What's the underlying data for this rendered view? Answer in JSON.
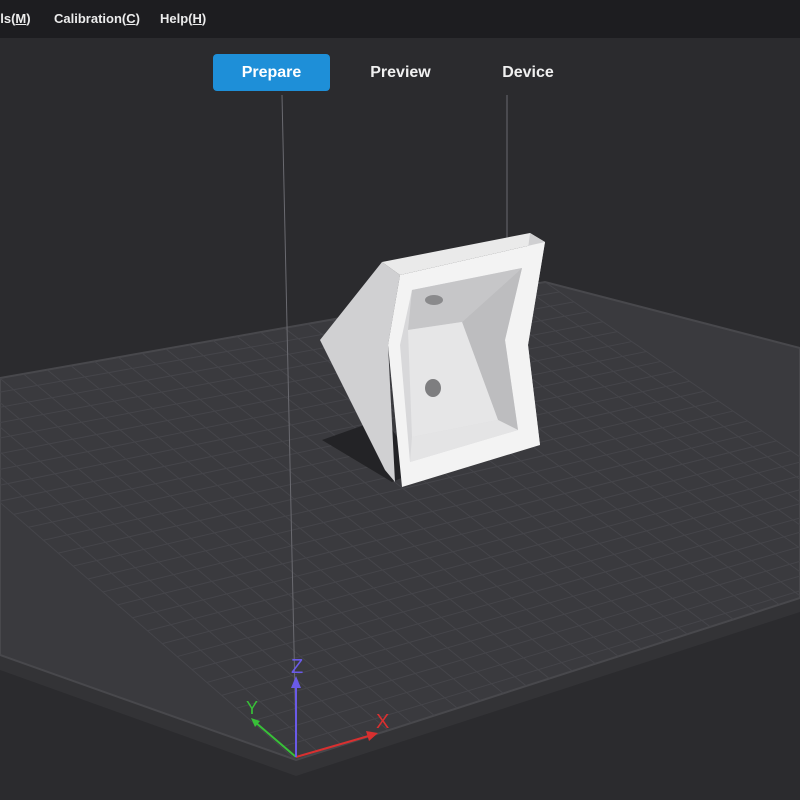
{
  "menubar": {
    "models_label": "els(",
    "models_key": "M",
    "models_end": ")",
    "calibration_label": "Calibration(",
    "calibration_key": "C",
    "calibration_end": ")",
    "help_label": "Help(",
    "help_key": "H",
    "help_end": ")"
  },
  "tabs": [
    {
      "label": "Prepare",
      "active": true
    },
    {
      "label": "Preview",
      "active": false
    },
    {
      "label": "Device",
      "active": false
    }
  ],
  "axes": {
    "x_label": "X",
    "y_label": "Y",
    "z_label": "Z",
    "x_color": "#d83030",
    "y_color": "#38c038",
    "z_color": "#6a5ae8"
  },
  "colors": {
    "background": "#2b2b2e",
    "plate": "#3a3a3e",
    "plate_edge": "#444448",
    "grid": "#46464b",
    "model": "#f2f2f2",
    "accent": "#1e8fd8"
  }
}
